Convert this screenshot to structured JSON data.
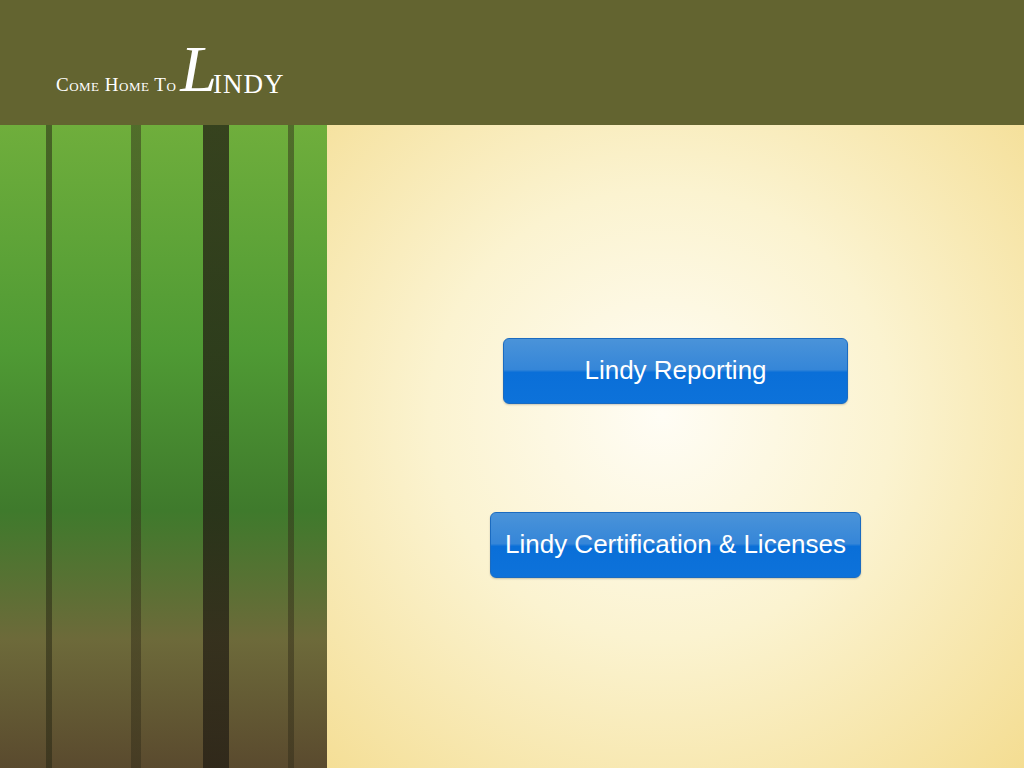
{
  "header": {
    "logo": {
      "prefix": "Come Home To",
      "initial": "L",
      "rest": "INDY"
    }
  },
  "buttons": [
    {
      "label": "Lindy Reporting"
    },
    {
      "label": "Lindy Certification & Licenses"
    }
  ]
}
